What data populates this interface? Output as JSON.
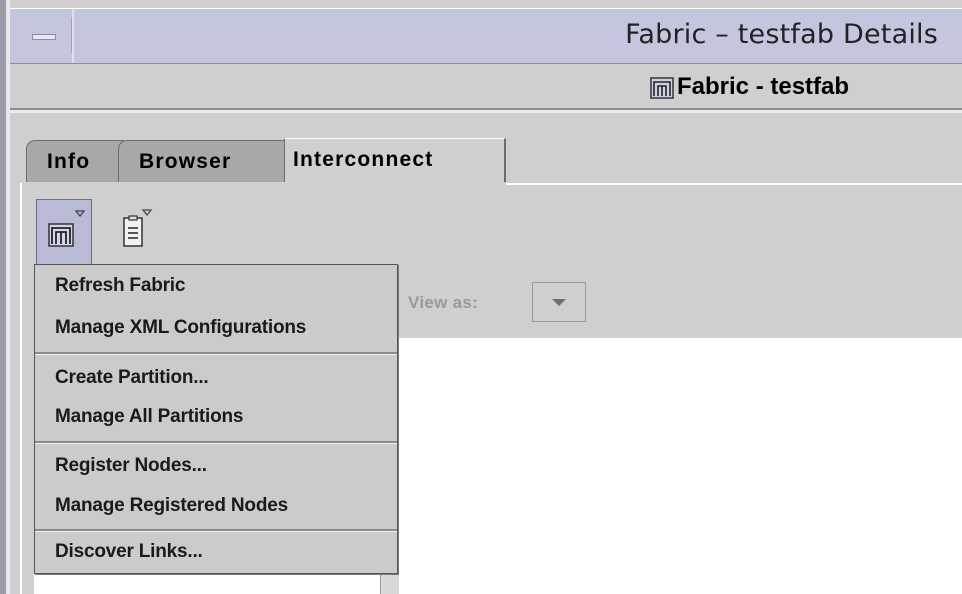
{
  "window": {
    "title": "Fabric – testfab Details",
    "header": "Fabric - testfab"
  },
  "tabs": [
    {
      "label": "Info",
      "selected": false
    },
    {
      "label": "Browser",
      "selected": false
    },
    {
      "label": "Interconnect",
      "selected": true
    }
  ],
  "toolbar": {
    "fabric_button_icon": "fabric-icon",
    "document_button_icon": "document-icon"
  },
  "view": {
    "label": "View as:",
    "selected_value": ""
  },
  "menu": {
    "items": [
      {
        "label": "Refresh Fabric"
      },
      {
        "label": "Manage XML Configurations"
      },
      {
        "label": "Create Partition..."
      },
      {
        "label": "Manage All Partitions"
      },
      {
        "label": "Register Nodes..."
      },
      {
        "label": "Manage Registered Nodes"
      },
      {
        "label": "Discover Links..."
      }
    ]
  },
  "colors": {
    "titlebar": "#c4c6e0",
    "panel": "#cfcfcf",
    "inactive_tab": "#a8a8a8",
    "toolbar_pressed": "#b8bad6"
  }
}
